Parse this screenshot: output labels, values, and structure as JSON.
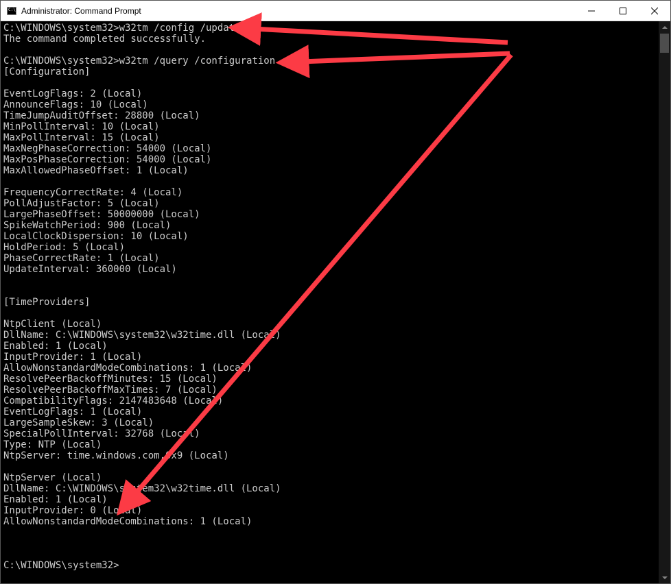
{
  "window": {
    "title": "Administrator: Command Prompt"
  },
  "terminal": {
    "lines": [
      "C:\\WINDOWS\\system32>w32tm /config /update",
      "The command completed successfully.",
      "",
      "C:\\WINDOWS\\system32>w32tm /query /configuration",
      "[Configuration]",
      "",
      "EventLogFlags: 2 (Local)",
      "AnnounceFlags: 10 (Local)",
      "TimeJumpAuditOffset: 28800 (Local)",
      "MinPollInterval: 10 (Local)",
      "MaxPollInterval: 15 (Local)",
      "MaxNegPhaseCorrection: 54000 (Local)",
      "MaxPosPhaseCorrection: 54000 (Local)",
      "MaxAllowedPhaseOffset: 1 (Local)",
      "",
      "FrequencyCorrectRate: 4 (Local)",
      "PollAdjustFactor: 5 (Local)",
      "LargePhaseOffset: 50000000 (Local)",
      "SpikeWatchPeriod: 900 (Local)",
      "LocalClockDispersion: 10 (Local)",
      "HoldPeriod: 5 (Local)",
      "PhaseCorrectRate: 1 (Local)",
      "UpdateInterval: 360000 (Local)",
      "",
      "",
      "[TimeProviders]",
      "",
      "NtpClient (Local)",
      "DllName: C:\\WINDOWS\\system32\\w32time.dll (Local)",
      "Enabled: 1 (Local)",
      "InputProvider: 1 (Local)",
      "AllowNonstandardModeCombinations: 1 (Local)",
      "ResolvePeerBackoffMinutes: 15 (Local)",
      "ResolvePeerBackoffMaxTimes: 7 (Local)",
      "CompatibilityFlags: 2147483648 (Local)",
      "EventLogFlags: 1 (Local)",
      "LargeSampleSkew: 3 (Local)",
      "SpecialPollInterval: 32768 (Local)",
      "Type: NTP (Local)",
      "NtpServer: time.windows.com,0x9 (Local)",
      "",
      "NtpServer (Local)",
      "DllName: C:\\WINDOWS\\system32\\w32time.dll (Local)",
      "Enabled: 1 (Local)",
      "InputProvider: 0 (Local)",
      "AllowNonstandardModeCombinations: 1 (Local)",
      "",
      "",
      "",
      "C:\\WINDOWS\\system32>"
    ]
  },
  "annotations": {
    "color": "#fc3b45"
  }
}
